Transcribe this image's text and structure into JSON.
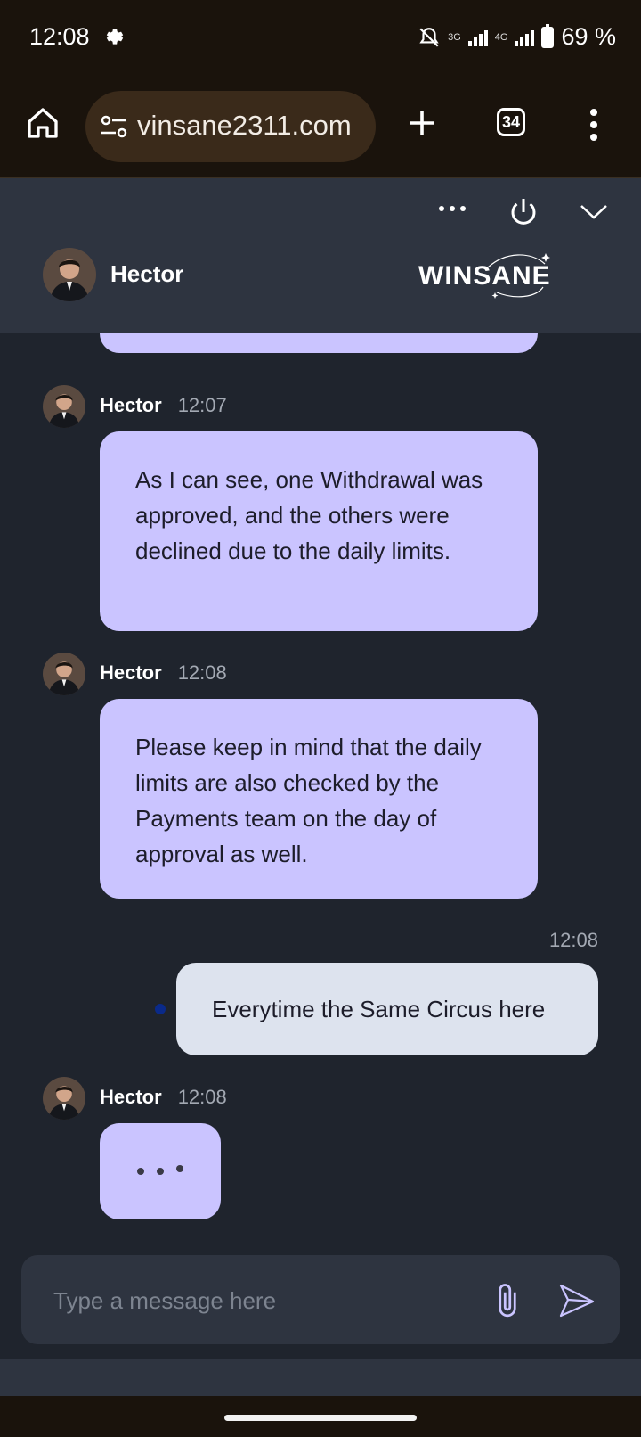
{
  "status_bar": {
    "time": "12:08",
    "network_3g": "3G",
    "network_4g": "4G",
    "battery": "69 %"
  },
  "browser": {
    "url": "vinsane2311.com",
    "tab_count": "34"
  },
  "chat_header": {
    "agent_name": "Hector",
    "brand": "WINSANE"
  },
  "messages": [
    {
      "sender": "Hector",
      "time": "12:07",
      "text": "As I can see, one Withdrawal was approved, and the others were declined due to the daily limits."
    },
    {
      "sender": "Hector",
      "time": "12:08",
      "text": "Please keep in mind that the daily limits are also checked by the Payments team on the day of approval as well."
    },
    {
      "sender": "user",
      "time": "12:08",
      "text": "Everytime the Same Circus here"
    },
    {
      "sender": "Hector",
      "time": "12:08",
      "typing": true
    }
  ],
  "composer": {
    "placeholder": "Type a message here"
  },
  "colors": {
    "agent_bubble": "#cac4ff",
    "user_bubble": "#dde3ee",
    "background": "#1f242d",
    "header": "#2e3440"
  },
  "icons": [
    "settings-icon",
    "mute-icon",
    "home-icon",
    "site-settings-icon",
    "plus-icon",
    "menu-icon",
    "more-icon",
    "power-icon",
    "chevron-down-icon",
    "paperclip-icon",
    "send-icon"
  ]
}
